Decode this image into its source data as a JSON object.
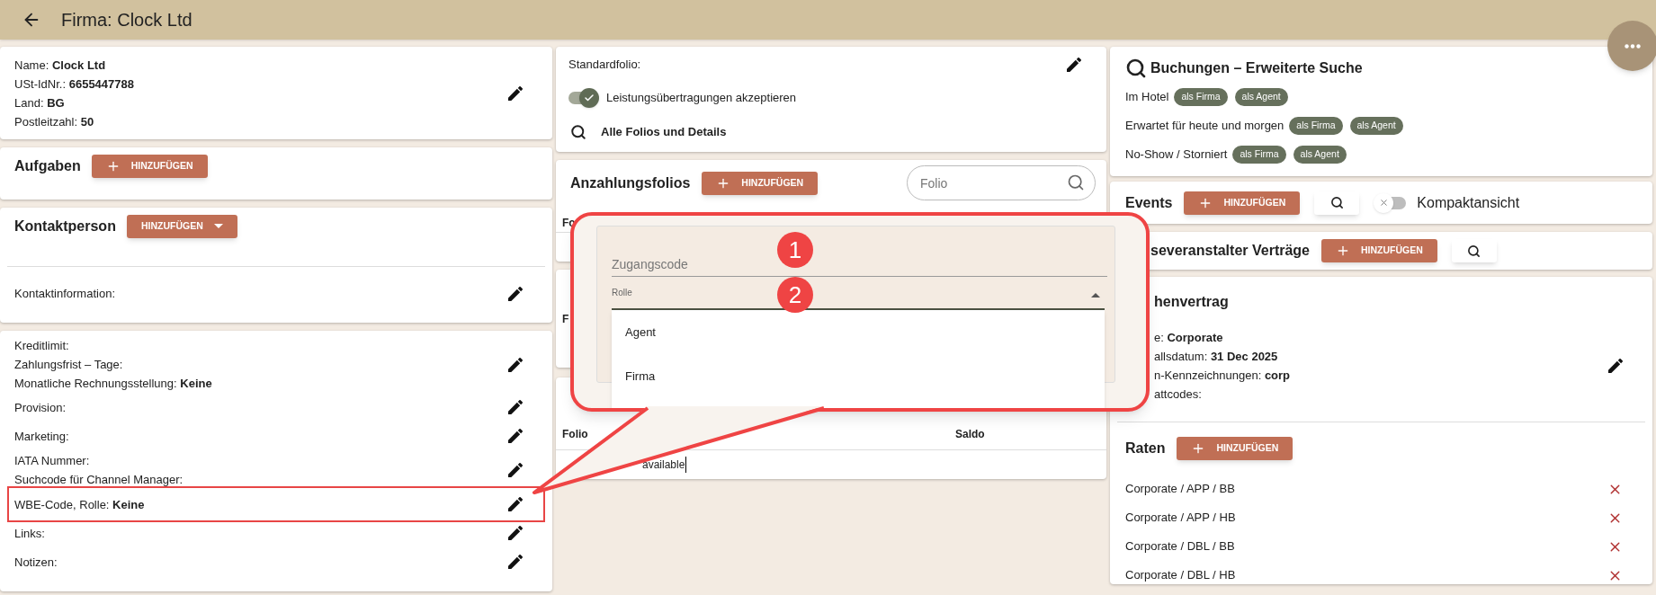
{
  "header": {
    "title": "Firma: Clock Ltd"
  },
  "company": {
    "lines": [
      "Name:  **Clock Ltd**",
      "USt-IdNr.: **6655447788**",
      "Land: **BG**",
      "Postleitzahl: **50**"
    ]
  },
  "tasks": {
    "title": "Aufgaben",
    "button": {
      "label": "HINZUFÜGEN",
      "kind": "add"
    }
  },
  "contact": {
    "title": "Kontaktperson",
    "button": {
      "label": "HINZUFÜGEN",
      "kind": "menu"
    },
    "info_label": "Kontaktinformation:"
  },
  "terms": {
    "groups": [
      {
        "lines": [
          "Kreditlimit:",
          "Zahlungsfrist – Tage:",
          "Monatliche Rechnungsstellung: **Keine**"
        ],
        "highlighted": false
      },
      {
        "lines": [
          "Provision:"
        ],
        "highlighted": false
      },
      {
        "lines": [
          "Marketing:"
        ],
        "highlighted": false
      },
      {
        "lines": [
          "IATA Nummer:",
          "Suchcode für Channel Manager:"
        ],
        "highlighted": false
      },
      {
        "lines": [
          "WBE-Code, Rolle: **Keine**"
        ],
        "highlighted": true
      },
      {
        "lines": [
          "Links:"
        ],
        "highlighted": false
      },
      {
        "lines": [
          "Notizen:"
        ],
        "highlighted": false
      }
    ]
  },
  "folio_card": {
    "default_label": "Standardfolio:",
    "transfer_toggle": {
      "label": "Leistungsübertragungen akzeptieren",
      "on": true
    },
    "all_folios_link": "Alle Folios und Details"
  },
  "deposit_folios": {
    "title": "Anzahlungsfolios",
    "button": {
      "label": "HINZUFÜGEN",
      "kind": "add"
    },
    "search": {
      "placeholder": "Folio"
    },
    "column_1": "Fo"
  },
  "hidden_card": {
    "column_1": "F"
  },
  "folio_table": {
    "columns": [
      "Folio",
      "Saldo"
    ],
    "empty_text": "available"
  },
  "bookings_search": {
    "title": "Buchungen – Erweiterte Suche",
    "rows": [
      {
        "label": "Im Hotel",
        "chips": [
          "als Firma",
          "als Agent"
        ]
      },
      {
        "label": "Erwartet für heute und morgen",
        "chips": [
          "als Firma",
          "als Agent"
        ]
      },
      {
        "label": "No-Show / Storniert",
        "chips": [
          "als Firma",
          "als Agent"
        ]
      }
    ]
  },
  "events": {
    "title": "Events",
    "button": {
      "label": "HINZUFÜGEN",
      "kind": "add"
    },
    "compact_toggle": {
      "label": "Kompaktansicht",
      "on": false
    }
  },
  "tour_operator_contracts": {
    "title": "severanstalter Verträge",
    "button": {
      "label": "HINZUFÜGEN",
      "kind": "add"
    }
  },
  "contract": {
    "title": "henvertrag",
    "lines": [
      "e: **Corporate**",
      "allsdatum: **31 Dec 2025**",
      "n-Kennzeichnungen: **corp**",
      "attcodes:"
    ]
  },
  "rates": {
    "title": "Raten",
    "button": {
      "label": "HINZUFÜGEN",
      "kind": "add"
    },
    "items": [
      "Corporate / APP / BB",
      "Corporate / APP / HB",
      "Corporate / DBL / BB",
      "Corporate / DBL / HB"
    ]
  },
  "callout": {
    "access_code": {
      "placeholder": "Zugangscode"
    },
    "role": {
      "label": "Rolle",
      "expanded": true
    },
    "options": [
      "Agent",
      "Firma"
    ],
    "markers": [
      "1",
      "2"
    ]
  }
}
